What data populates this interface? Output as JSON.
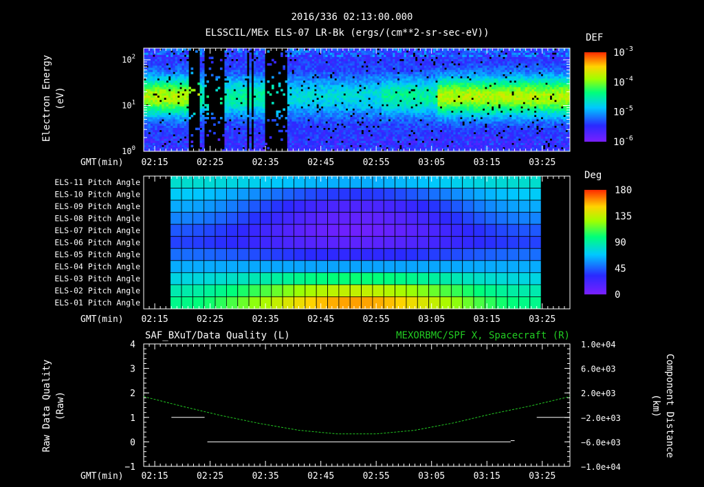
{
  "header": {
    "title": "2016/336 02:13:00.000",
    "subtitle": "ELSSCIL/MEx ELS-07 LR-Bk  (ergs/(cm**2-sr-sec-eV))"
  },
  "time_axis": {
    "label": "GMT(min)",
    "ticks": [
      "02:15",
      "02:25",
      "02:35",
      "02:45",
      "02:55",
      "03:05",
      "03:15",
      "03:25"
    ],
    "range_minutes": [
      133,
      210
    ]
  },
  "chart_data": [
    {
      "type": "heatmap",
      "name": "electron-spectrogram",
      "ylabel_line1": "Electron Energy",
      "ylabel_line2": "(eV)",
      "y_scale": "log",
      "ylim": [
        1,
        180
      ],
      "y_ticks": [
        {
          "base": "10",
          "exp": "0",
          "value": 1
        },
        {
          "base": "10",
          "exp": "1",
          "value": 10
        },
        {
          "base": "10",
          "exp": "2",
          "value": 100
        }
      ],
      "colorbar": {
        "title": "DEF",
        "scale": "log",
        "range": [
          1e-06,
          0.001
        ],
        "ticks": [
          {
            "base": "10",
            "exp": "-3",
            "value": 0.001
          },
          {
            "base": "10",
            "exp": "-4",
            "value": 0.0001
          },
          {
            "base": "10",
            "exp": "-5",
            "value": 1e-05
          },
          {
            "base": "10",
            "exp": "-6",
            "value": 1e-06
          }
        ]
      },
      "gaps_minutes": [
        [
          141.0,
          143.0
        ],
        [
          143.8,
          147.5
        ],
        [
          151.5,
          152.0
        ],
        [
          152.5,
          153.0
        ],
        [
          155.0,
          159.0
        ]
      ],
      "cells_x": 190,
      "cells_y": 48
    },
    {
      "type": "heatmap",
      "name": "pitch-angle-grid",
      "row_labels": [
        "ELS-11 Pitch Angle",
        "ELS-10 Pitch Angle",
        "ELS-09 Pitch Angle",
        "ELS-08 Pitch Angle",
        "ELS-07 Pitch Angle",
        "ELS-06 Pitch Angle",
        "ELS-05 Pitch Angle",
        "ELS-04 Pitch Angle",
        "ELS-03 Pitch Angle",
        "ELS-02 Pitch Angle",
        "ELS-01 Pitch Angle"
      ],
      "x_range_minutes": [
        137.8,
        204.8
      ],
      "columns": 33,
      "colorbar": {
        "title": "Deg",
        "range": [
          0,
          180
        ],
        "ticks": [
          "180",
          "135",
          "90",
          "45",
          "0"
        ]
      },
      "row_values_at_edges": [
        80,
        70,
        62,
        53,
        43,
        38,
        48,
        62,
        75,
        87,
        95
      ],
      "row_values_at_center": [
        62,
        35,
        18,
        10,
        5,
        12,
        30,
        60,
        100,
        135,
        160
      ]
    },
    {
      "type": "line",
      "name": "data-quality-and-position",
      "left_title": "SAF_BXuT/Data Quality (L)",
      "right_title": "MEXORBMC/SPF X, Spacecraft (R)",
      "ylabel_left_line1": "Raw Data Quality",
      "ylabel_left_line2": "(Raw)",
      "ylabel_right_line1": "Component Distance",
      "ylabel_right_line2": "(km)",
      "ylim_left": [
        -1,
        4
      ],
      "y_ticks_left": [
        "4",
        "3",
        "2",
        "1",
        "0",
        "−1"
      ],
      "ylim_right": [
        -10000,
        10000
      ],
      "y_ticks_right": [
        "1.0e+04",
        "6.0e+03",
        "2.0e+03",
        "−2.0e+03",
        "−6.0e+03",
        "−1.0e+04"
      ],
      "series": [
        {
          "name": "SAF_BXuT/Data Quality (L)",
          "axis": "left",
          "color": "#ffffff",
          "segments": [
            {
              "x": [
                138,
                144
              ],
              "y": [
                1,
                1
              ]
            },
            {
              "x": [
                144.5,
                199.3
              ],
              "y": [
                0,
                0
              ]
            },
            {
              "x": [
                199.3,
                200
              ],
              "y": [
                0.05,
                0.05
              ]
            },
            {
              "x": [
                204,
                210
              ],
              "y": [
                1,
                1
              ]
            }
          ]
        },
        {
          "name": "MEXORBMC/SPF X, Spacecraft (R)",
          "axis": "right",
          "color": "#22cc22",
          "x": [
            133,
            140,
            147,
            154,
            161,
            168,
            175,
            182,
            189,
            196,
            203,
            210
          ],
          "y": [
            1400,
            -200,
            -1700,
            -3000,
            -4100,
            -4700,
            -4700,
            -4100,
            -2900,
            -1400,
            -100,
            1400
          ]
        }
      ]
    }
  ]
}
